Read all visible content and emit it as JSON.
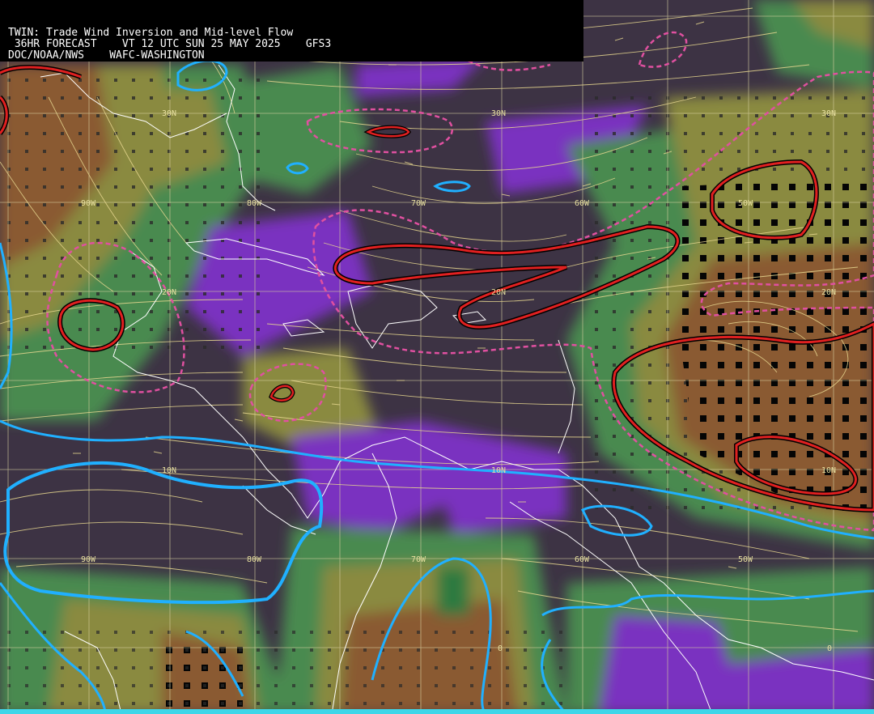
{
  "header": {
    "line1": "TWIN: Trade Wind Inversion and Mid-level Flow",
    "line2": " 36HR FORECAST    VT 12 UTC SUN 25 MAY 2025    GFS3",
    "line3": "DOC/NOAA/NWS    WAFC-WASHINGTON"
  },
  "lat_labels": [
    "30N",
    "30N",
    "30N",
    "20N",
    "20N",
    "20N",
    "10N",
    "10N",
    "10N",
    "0",
    "0"
  ],
  "lon_labels": [
    "90W",
    "80W",
    "70W",
    "60W",
    "50W",
    "90W",
    "80W",
    "70W",
    "60W",
    "50W"
  ],
  "colors": {
    "background": "#3d3344",
    "purple": "#7a30c0",
    "blue_band": "#4a5aa0",
    "green": "#4a8a50",
    "olive": "#8a8a40",
    "brown": "#8a5a30",
    "red_contour": "#e02020",
    "pink_dashed": "#e050a0",
    "cyan_contour": "#20b0ff",
    "grid": "#d8d0a0",
    "coast": "#ffffff",
    "header_bg": "#000000",
    "header_text": "#ffffff"
  }
}
